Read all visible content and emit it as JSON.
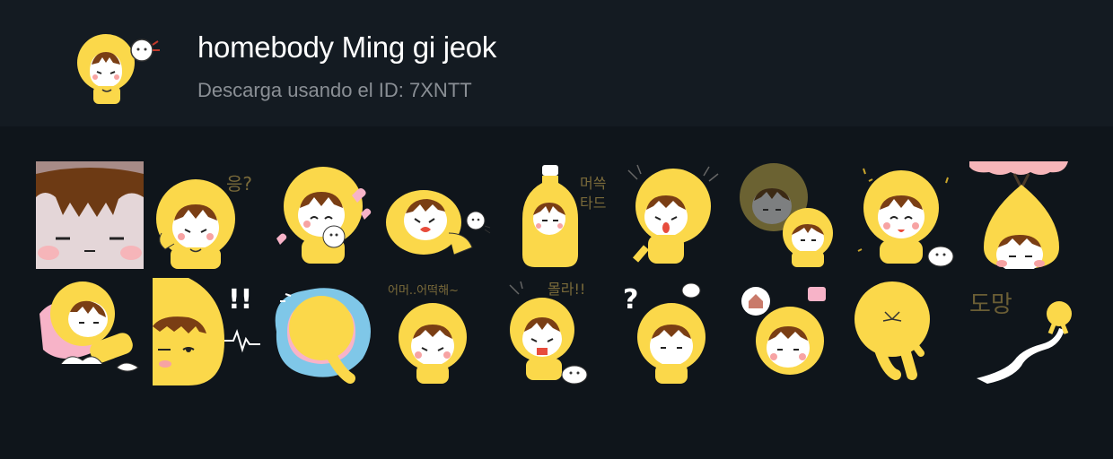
{
  "header": {
    "title": "homebody Ming gi jeok",
    "subtitle": "Descarga usando el ID: 7XNTT",
    "icon": "pack-character-icon"
  },
  "colors": {
    "background": "#0f151b",
    "header_bg": "#141b22",
    "character_yellow": "#fbd84a",
    "hair_brown": "#7a3e14",
    "title_text": "#ffffff",
    "subtitle_text": "#8a8f95"
  },
  "stickers": [
    {
      "id": "sticker-1",
      "icon": "closeup-bored-face",
      "text": ""
    },
    {
      "id": "sticker-2",
      "icon": "wondering-character",
      "text": "응?"
    },
    {
      "id": "sticker-3",
      "icon": "hugging-puppy-hearts",
      "text": ""
    },
    {
      "id": "sticker-4",
      "icon": "crying-lying-character",
      "text": ""
    },
    {
      "id": "sticker-5",
      "icon": "bottle-character",
      "text": "머쓱\n타드"
    },
    {
      "id": "sticker-6",
      "icon": "shocked-character",
      "text": ""
    },
    {
      "id": "sticker-7",
      "icon": "gloomy-shadow-character",
      "text": ""
    },
    {
      "id": "sticker-8",
      "icon": "happy-with-pet",
      "text": ""
    },
    {
      "id": "sticker-9",
      "icon": "peeking-under-tree",
      "text": ""
    },
    {
      "id": "sticker-10",
      "icon": "sleeping-on-pillow",
      "text": ""
    },
    {
      "id": "sticker-11",
      "icon": "side-glance-heartbeat",
      "text": "!!"
    },
    {
      "id": "sticker-12",
      "icon": "lying-on-cloud",
      "text": ""
    },
    {
      "id": "sticker-13",
      "icon": "panicking-character",
      "text": "어머..어떡해~"
    },
    {
      "id": "sticker-14",
      "icon": "shouting-character",
      "text": "몰라!!"
    },
    {
      "id": "sticker-15",
      "icon": "confused-character",
      "text": "?"
    },
    {
      "id": "sticker-16",
      "icon": "thinking-of-home",
      "text": ""
    },
    {
      "id": "sticker-17",
      "icon": "back-view-character",
      "text": ""
    },
    {
      "id": "sticker-18",
      "icon": "running-away",
      "text": "도망"
    }
  ]
}
